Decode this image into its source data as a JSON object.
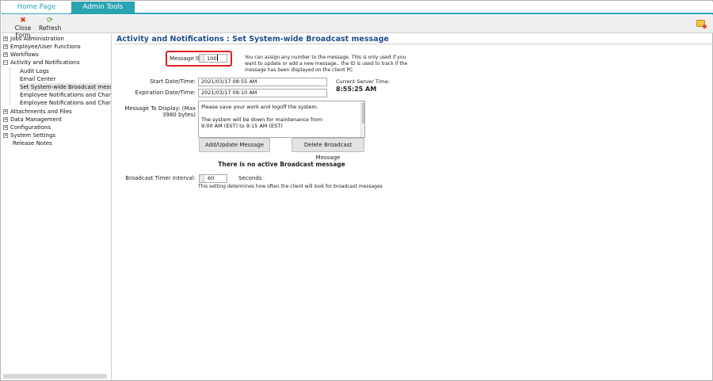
{
  "tabs": {
    "home": "Home Page",
    "admin": "Admin Tools"
  },
  "toolbar": {
    "close_icon": "close-x-icon",
    "close_label": "Close Form",
    "refresh_icon": "refresh-icon",
    "refresh_label": "Refresh"
  },
  "sidebar": {
    "items": [
      {
        "label": "Jobs Administration",
        "expander": "+"
      },
      {
        "label": "Employee/User Functions",
        "expander": "+"
      },
      {
        "label": "Workflows",
        "expander": "+"
      },
      {
        "label": "Activity and Notifications",
        "expander": "−"
      },
      {
        "label": "Audit Logs"
      },
      {
        "label": "Email Center"
      },
      {
        "label": "Set System-wide Broadcast message"
      },
      {
        "label": "Employee Notifications and Change even"
      },
      {
        "label": "Employee Notifications and Change even"
      },
      {
        "label": "Attachments and Files",
        "expander": "+"
      },
      {
        "label": "Data Management",
        "expander": "+"
      },
      {
        "label": "Configurations",
        "expander": "+"
      },
      {
        "label": "System Settings",
        "expander": "+"
      },
      {
        "label": "Release Notes"
      }
    ]
  },
  "main": {
    "title": "Activity and Notifications : Set System-wide Broadcast message",
    "message_id_label": "Message ID:",
    "message_id_value": "100",
    "help_text": "You can assign any number to the message. This is only used if you want to update or add a new message.. the ID is used to track if the message has been displayed on the client PC",
    "start_label": "Start Date/Time:",
    "start_value": "2021/03/17 08:55 AM",
    "expiration_label": "Expiration Date/Time:",
    "expiration_value": "2021/03/17 09:10 AM",
    "server_time_label": "Current Server Time:",
    "server_time_value": "8:55:25 AM",
    "message_label_1": "Message To Display: (Max",
    "message_label_2": "3980 bytes)",
    "message_lines": [
      "Please save your work and logoff the system.",
      "",
      "The system will be down for maintenance from",
      "9:00 AM (EST) to 9:15 AM (EST)"
    ],
    "add_update_button": "Add/Update Message",
    "delete_button": "Delete Broadcast Message",
    "no_active": "There is no active Broadcast message",
    "timer_label": "Broadcast Timer Interval:",
    "timer_value": "60",
    "timer_unit": "Seconds",
    "timer_help": "This setting determines how often the client will look for broadcast messages"
  },
  "colors": {
    "accent": "#2aa3b2",
    "title": "#1f4e8c",
    "highlight": "#e02020"
  }
}
